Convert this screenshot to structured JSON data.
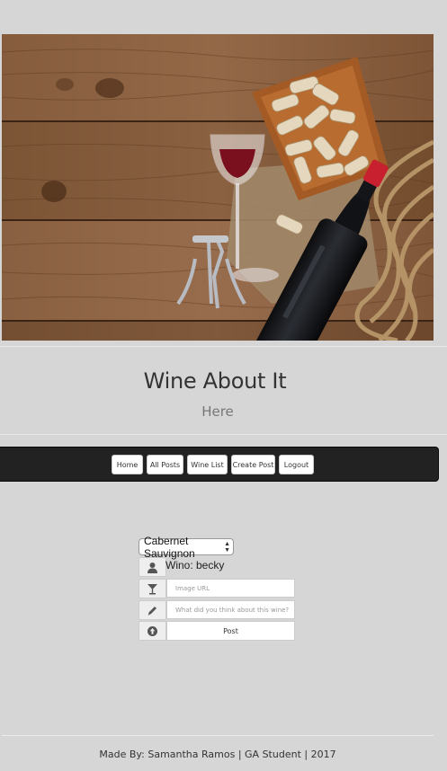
{
  "header": {
    "title": "Wine About It",
    "subtitle": "Here"
  },
  "nav": {
    "items": [
      {
        "label": "Home"
      },
      {
        "label": "All Posts"
      },
      {
        "label": "Wine List"
      },
      {
        "label": "Create Post"
      },
      {
        "label": "Logout"
      }
    ]
  },
  "form": {
    "wine_select": {
      "selected": "Cabernet Sauvignon"
    },
    "wino_label": "Wino: becky",
    "image_url": {
      "placeholder": "Image URL",
      "value": ""
    },
    "review": {
      "placeholder": "What did you think about this wine?",
      "value": ""
    },
    "post_label": "Post",
    "icons": [
      "user-icon",
      "glass-icon",
      "pencil-icon",
      "upload-icon"
    ]
  },
  "footer": {
    "text": "Made By: Samantha Ramos | GA Student | 2017"
  },
  "colors": {
    "page_bg": "#d6d6d6",
    "navbar_bg": "#222222",
    "wood": "#8a5f3c",
    "bottle_cap": "#c8202e"
  }
}
